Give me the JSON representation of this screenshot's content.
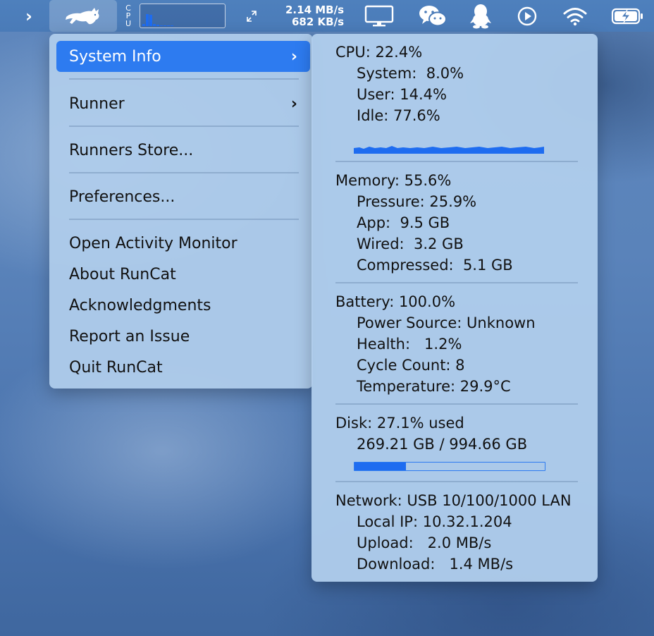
{
  "menubar": {
    "chevron": "›",
    "cpu_letters": [
      "C",
      "P",
      "U"
    ],
    "cpu_graph_values": [
      0.12,
      0.62,
      0.58,
      0.1,
      0.06,
      0.05,
      0.05,
      0.05,
      0.05
    ],
    "upload_rate": "2.14 MB/s",
    "download_rate": "682 KB/s",
    "icons": [
      "cat-runner-icon",
      "monitor-icon",
      "wechat-icon",
      "qq-penguin-icon",
      "play-circle-icon",
      "wifi-icon",
      "battery-charging-icon"
    ]
  },
  "menu": {
    "items": [
      {
        "label": "System Info",
        "submenu": true,
        "selected": true
      },
      {
        "label": "Runner",
        "submenu": true
      },
      {
        "label": "Runners Store..."
      },
      {
        "label": "Preferences..."
      },
      {
        "label": "Open Activity Monitor"
      },
      {
        "label": "About RunCat"
      },
      {
        "label": "Acknowledgments"
      },
      {
        "label": "Report an Issue"
      },
      {
        "label": "Quit RunCat"
      }
    ],
    "chevron": "›"
  },
  "panel": {
    "cpu": {
      "title": "CPU: 22.4%",
      "system": "System:  8.0%",
      "user": "User: 14.4%",
      "idle": "Idle: 77.6%"
    },
    "memory": {
      "title": "Memory: 55.6%",
      "pressure": "Pressure: 25.9%",
      "app": "App:  9.5 GB",
      "wired": "Wired:  3.2 GB",
      "compressed": "Compressed:  5.1 GB"
    },
    "battery": {
      "title": "Battery: 100.0%",
      "power_source": "Power Source: Unknown",
      "health": "Health:   1.2%",
      "cycle_count": "Cycle Count: 8",
      "temperature": "Temperature: 29.9°C"
    },
    "disk": {
      "title": "Disk: 27.1% used",
      "usage": "269.21 GB / 994.66 GB",
      "used_fraction": 0.271
    },
    "network": {
      "title": "Network: USB 10/100/1000 LAN",
      "local_ip": "Local IP: 10.32.1.204",
      "upload": "Upload:   2.0 MB/s",
      "download": "Download:   1.4 MB/s"
    }
  },
  "colors": {
    "accent": "#2d7bf0",
    "graph": "#1e6cf0"
  }
}
